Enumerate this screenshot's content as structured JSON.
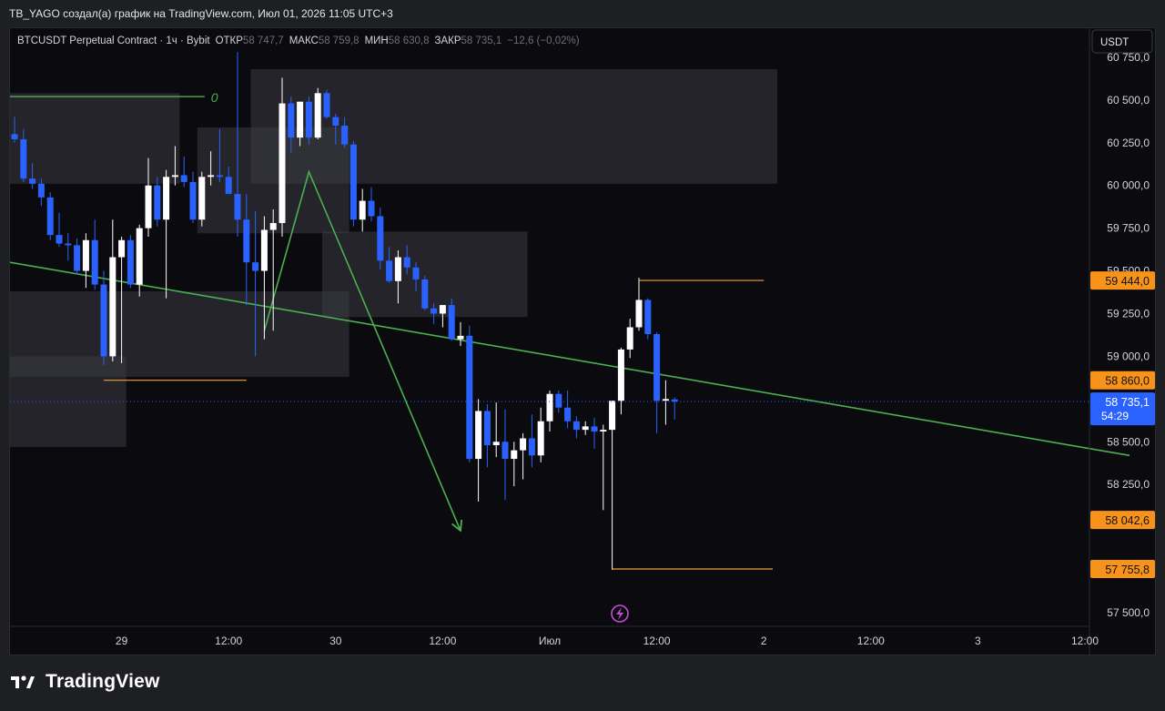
{
  "attribution": "TB_YAGO создал(а) график на TradingView.com, Июл 01, 2026 11:05 UTC+3",
  "legend": {
    "symbol": "BTCUSDT Perpetual Contract · 1ч · Bybit",
    "open_label": "ОТКР",
    "open_value": "58 747,7",
    "high_label": "МАКС",
    "high_value": "58 759,8",
    "low_label": "МИН",
    "low_value": "58 630,8",
    "close_label": "ЗАКР",
    "close_value": "58 735,1",
    "change": "−12,6 (−0,02%)"
  },
  "currency_button": "USDT",
  "footer": {
    "brand": "TradingView"
  },
  "annotation_label": "0",
  "colors": {
    "up": "#ffffff",
    "down": "#2962ff",
    "trendline": "#4caf50",
    "level": "#f0a030",
    "zone": "#3a3b42",
    "price_badge_bg": "#2962ff",
    "level_badge_bg": "#f7931a"
  },
  "chart_data": {
    "type": "candlestick",
    "ylim": [
      57420,
      60920
    ],
    "y_ticks": [
      {
        "value": 60750,
        "label": "60 750,0"
      },
      {
        "value": 60500,
        "label": "60 500,0"
      },
      {
        "value": 60250,
        "label": "60 250,0"
      },
      {
        "value": 60000,
        "label": "60 000,0"
      },
      {
        "value": 59750,
        "label": "59 750,0"
      },
      {
        "value": 59500,
        "label": "59 500,0"
      },
      {
        "value": 59250,
        "label": "59 250,0"
      },
      {
        "value": 59000,
        "label": "59 000,0"
      },
      {
        "value": 58500,
        "label": "58 500,0"
      },
      {
        "value": 58250,
        "label": "58 250,0"
      },
      {
        "value": 57500,
        "label": "57 500,0"
      }
    ],
    "x_ticks": [
      {
        "index": 12,
        "label": "29"
      },
      {
        "index": 24,
        "label": "12:00"
      },
      {
        "index": 36,
        "label": "30"
      },
      {
        "index": 48,
        "label": "12:00"
      },
      {
        "index": 60,
        "label": "Июл"
      },
      {
        "index": 72,
        "label": "12:00"
      },
      {
        "index": 84,
        "label": "2"
      },
      {
        "index": 96,
        "label": "12:00"
      },
      {
        "index": 108,
        "label": "3"
      },
      {
        "index": 120,
        "label": "12:00"
      }
    ],
    "candles": [
      {
        "i": 0,
        "o": 60300,
        "h": 60400,
        "l": 60250,
        "c": 60270
      },
      {
        "i": 1,
        "o": 60270,
        "h": 60330,
        "l": 60020,
        "c": 60040
      },
      {
        "i": 2,
        "o": 60040,
        "h": 60130,
        "l": 59980,
        "c": 60010
      },
      {
        "i": 3,
        "o": 60010,
        "h": 60040,
        "l": 59880,
        "c": 59930
      },
      {
        "i": 4,
        "o": 59930,
        "h": 59960,
        "l": 59680,
        "c": 59710
      },
      {
        "i": 5,
        "o": 59710,
        "h": 59840,
        "l": 59640,
        "c": 59660
      },
      {
        "i": 6,
        "o": 59660,
        "h": 59720,
        "l": 59560,
        "c": 59650
      },
      {
        "i": 7,
        "o": 59650,
        "h": 59690,
        "l": 59480,
        "c": 59500
      },
      {
        "i": 8,
        "o": 59500,
        "h": 59720,
        "l": 59400,
        "c": 59680
      },
      {
        "i": 9,
        "o": 59680,
        "h": 59800,
        "l": 59390,
        "c": 59420
      },
      {
        "i": 10,
        "o": 59420,
        "h": 59500,
        "l": 58950,
        "c": 59000
      },
      {
        "i": 11,
        "o": 59000,
        "h": 59800,
        "l": 58970,
        "c": 59580
      },
      {
        "i": 12,
        "o": 59580,
        "h": 59700,
        "l": 58960,
        "c": 59680
      },
      {
        "i": 13,
        "o": 59680,
        "h": 59710,
        "l": 59400,
        "c": 59420
      },
      {
        "i": 14,
        "o": 59420,
        "h": 59770,
        "l": 59350,
        "c": 59750
      },
      {
        "i": 15,
        "o": 59750,
        "h": 60160,
        "l": 59700,
        "c": 60000
      },
      {
        "i": 16,
        "o": 60000,
        "h": 60050,
        "l": 59760,
        "c": 59800
      },
      {
        "i": 17,
        "o": 59800,
        "h": 60090,
        "l": 59340,
        "c": 60050
      },
      {
        "i": 18,
        "o": 60050,
        "h": 60230,
        "l": 60000,
        "c": 60060
      },
      {
        "i": 19,
        "o": 60060,
        "h": 60170,
        "l": 59990,
        "c": 60020
      },
      {
        "i": 20,
        "o": 60020,
        "h": 60080,
        "l": 59780,
        "c": 59800
      },
      {
        "i": 21,
        "o": 59800,
        "h": 60080,
        "l": 59760,
        "c": 60050
      },
      {
        "i": 22,
        "o": 60050,
        "h": 60200,
        "l": 60000,
        "c": 60060
      },
      {
        "i": 23,
        "o": 60060,
        "h": 60330,
        "l": 60020,
        "c": 60050
      },
      {
        "i": 24,
        "o": 60050,
        "h": 60110,
        "l": 59950,
        "c": 59950
      },
      {
        "i": 25,
        "o": 59950,
        "h": 60780,
        "l": 59700,
        "c": 59800
      },
      {
        "i": 26,
        "o": 59800,
        "h": 59950,
        "l": 59300,
        "c": 59550
      },
      {
        "i": 27,
        "o": 59550,
        "h": 59850,
        "l": 59000,
        "c": 59500
      },
      {
        "i": 28,
        "o": 59500,
        "h": 59820,
        "l": 59100,
        "c": 59740
      },
      {
        "i": 29,
        "o": 59740,
        "h": 59860,
        "l": 59150,
        "c": 59780
      },
      {
        "i": 30,
        "o": 59780,
        "h": 60630,
        "l": 59700,
        "c": 60480
      },
      {
        "i": 31,
        "o": 60480,
        "h": 60520,
        "l": 60190,
        "c": 60280
      },
      {
        "i": 32,
        "o": 60280,
        "h": 60490,
        "l": 60230,
        "c": 60490
      },
      {
        "i": 33,
        "o": 60490,
        "h": 60520,
        "l": 60240,
        "c": 60280
      },
      {
        "i": 34,
        "o": 60280,
        "h": 60570,
        "l": 60270,
        "c": 60540
      },
      {
        "i": 35,
        "o": 60540,
        "h": 60560,
        "l": 60390,
        "c": 60400
      },
      {
        "i": 36,
        "o": 60400,
        "h": 60420,
        "l": 60240,
        "c": 60350
      },
      {
        "i": 37,
        "o": 60350,
        "h": 60400,
        "l": 60220,
        "c": 60240
      },
      {
        "i": 38,
        "o": 60240,
        "h": 60260,
        "l": 59760,
        "c": 59800
      },
      {
        "i": 39,
        "o": 59800,
        "h": 59980,
        "l": 59730,
        "c": 59910
      },
      {
        "i": 40,
        "o": 59910,
        "h": 59990,
        "l": 59790,
        "c": 59820
      },
      {
        "i": 41,
        "o": 59820,
        "h": 59870,
        "l": 59510,
        "c": 59560
      },
      {
        "i": 42,
        "o": 59560,
        "h": 59640,
        "l": 59430,
        "c": 59440
      },
      {
        "i": 43,
        "o": 59440,
        "h": 59620,
        "l": 59310,
        "c": 59580
      },
      {
        "i": 44,
        "o": 59580,
        "h": 59650,
        "l": 59480,
        "c": 59520
      },
      {
        "i": 45,
        "o": 59520,
        "h": 59550,
        "l": 59380,
        "c": 59450
      },
      {
        "i": 46,
        "o": 59450,
        "h": 59470,
        "l": 59270,
        "c": 59280
      },
      {
        "i": 47,
        "o": 59280,
        "h": 59310,
        "l": 59190,
        "c": 59250
      },
      {
        "i": 48,
        "o": 59250,
        "h": 59300,
        "l": 59170,
        "c": 59300
      },
      {
        "i": 49,
        "o": 59300,
        "h": 59340,
        "l": 59090,
        "c": 59100
      },
      {
        "i": 50,
        "o": 59100,
        "h": 59200,
        "l": 59060,
        "c": 59120
      },
      {
        "i": 51,
        "o": 59120,
        "h": 59180,
        "l": 58380,
        "c": 58400
      },
      {
        "i": 52,
        "o": 58400,
        "h": 58750,
        "l": 58150,
        "c": 58680
      },
      {
        "i": 53,
        "o": 58680,
        "h": 58720,
        "l": 58350,
        "c": 58480
      },
      {
        "i": 54,
        "o": 58480,
        "h": 58730,
        "l": 58410,
        "c": 58500
      },
      {
        "i": 55,
        "o": 58500,
        "h": 58690,
        "l": 58160,
        "c": 58400
      },
      {
        "i": 56,
        "o": 58400,
        "h": 58500,
        "l": 58240,
        "c": 58450
      },
      {
        "i": 57,
        "o": 58450,
        "h": 58550,
        "l": 58280,
        "c": 58520
      },
      {
        "i": 58,
        "o": 58520,
        "h": 58660,
        "l": 58350,
        "c": 58420
      },
      {
        "i": 59,
        "o": 58420,
        "h": 58700,
        "l": 58380,
        "c": 58620
      },
      {
        "i": 60,
        "o": 58620,
        "h": 58800,
        "l": 58560,
        "c": 58780
      },
      {
        "i": 61,
        "o": 58780,
        "h": 58800,
        "l": 58670,
        "c": 58700
      },
      {
        "i": 62,
        "o": 58700,
        "h": 58800,
        "l": 58580,
        "c": 58620
      },
      {
        "i": 63,
        "o": 58620,
        "h": 58650,
        "l": 58520,
        "c": 58570
      },
      {
        "i": 64,
        "o": 58570,
        "h": 58620,
        "l": 58540,
        "c": 58590
      },
      {
        "i": 65,
        "o": 58590,
        "h": 58640,
        "l": 58460,
        "c": 58560
      },
      {
        "i": 66,
        "o": 58560,
        "h": 58600,
        "l": 58100,
        "c": 58570
      },
      {
        "i": 67,
        "o": 58570,
        "h": 58740,
        "l": 57750,
        "c": 58740
      },
      {
        "i": 68,
        "o": 58740,
        "h": 59050,
        "l": 58660,
        "c": 59040
      },
      {
        "i": 69,
        "o": 59040,
        "h": 59220,
        "l": 58990,
        "c": 59170
      },
      {
        "i": 70,
        "o": 59170,
        "h": 59460,
        "l": 59150,
        "c": 59330
      },
      {
        "i": 71,
        "o": 59330,
        "h": 59340,
        "l": 59100,
        "c": 59130
      },
      {
        "i": 72,
        "o": 59130,
        "h": 59140,
        "l": 58550,
        "c": 58740
      },
      {
        "i": 73,
        "o": 58740,
        "h": 58860,
        "l": 58600,
        "c": 58750
      },
      {
        "i": 74,
        "o": 58747.7,
        "h": 58759.8,
        "l": 58630.8,
        "c": 58735.1
      }
    ],
    "zones": [
      {
        "i0": 0,
        "i1": 18,
        "y0": 60010,
        "y1": 60540
      },
      {
        "i0": 21,
        "i1": 37,
        "y0": 59720,
        "y1": 60340
      },
      {
        "i0": 27,
        "i1": 85,
        "y0": 60010,
        "y1": 60680
      },
      {
        "i0": 35,
        "i1": 57,
        "y0": 59230,
        "y1": 59730
      },
      {
        "i0": 0,
        "i1": 37,
        "y0": 58880,
        "y1": 59380
      },
      {
        "i0": 0,
        "i1": 12,
        "y0": 58470,
        "y1": 59000
      }
    ],
    "levels": [
      {
        "value": 59444.0,
        "label": "59 444,0",
        "i0": 70,
        "i1": 84
      },
      {
        "value": 58860.0,
        "label": "58 860,0",
        "i0": 10,
        "i1": 26
      },
      {
        "value": 58042.6,
        "label": "58 042,6",
        "i0": null,
        "i1": null
      },
      {
        "value": 57755.8,
        "label": "57 755,8",
        "i0": 67,
        "i1": 85
      }
    ],
    "green_level": {
      "value": 60520,
      "i0": 0,
      "i1": 21
    },
    "trendline": {
      "i0": 0,
      "v0": 59550,
      "i1": 125,
      "v1": 58420
    },
    "path": [
      {
        "i": 28,
        "v": 59150
      },
      {
        "i": 33,
        "v": 60080
      },
      {
        "i": 50,
        "v": 57980
      }
    ],
    "last_price": {
      "value": 58735.1,
      "label": "58 735,1",
      "timer": "54:29"
    }
  }
}
